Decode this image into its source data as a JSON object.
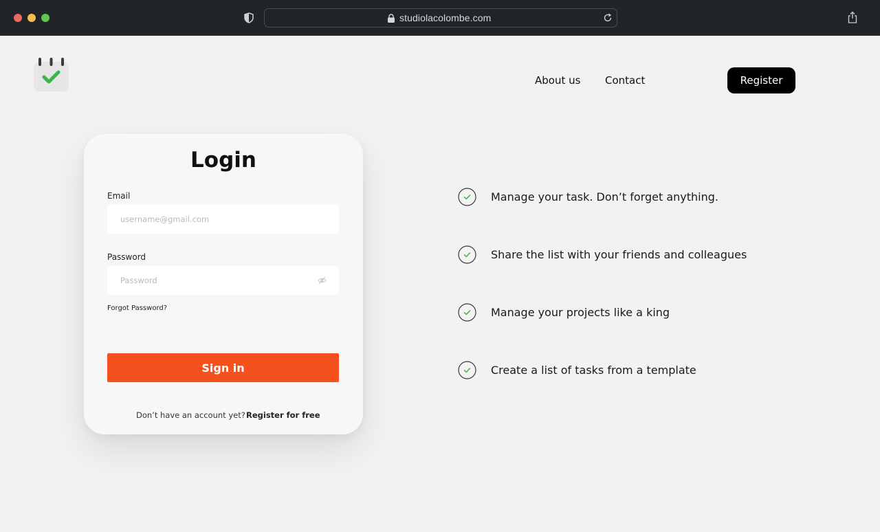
{
  "browser": {
    "url": "studiolacolombe.com"
  },
  "header": {
    "logo_icon": "calendar-check-icon",
    "nav": [
      {
        "label": "About us"
      },
      {
        "label": "Contact"
      }
    ],
    "register_label": "Register"
  },
  "login": {
    "title": "Login",
    "email_label": "Email",
    "email_placeholder": "username@gmail.com",
    "password_label": "Password",
    "password_placeholder": "Password",
    "forgot_label": "Forgot Password?",
    "signin_label": "Sign in",
    "no_account_text": "Don’t have an account yet?",
    "register_free_label": "Register for free"
  },
  "features": [
    {
      "text": "Manage your task. Don’t forget anything."
    },
    {
      "text": "Share the list with your friends and colleagues"
    },
    {
      "text": "Manage your projects like a king"
    },
    {
      "text": "Create a list of tasks from a template"
    }
  ],
  "colors": {
    "accent": "#f4511e",
    "check": "#3ab54a",
    "background": "#f2f2f2"
  }
}
